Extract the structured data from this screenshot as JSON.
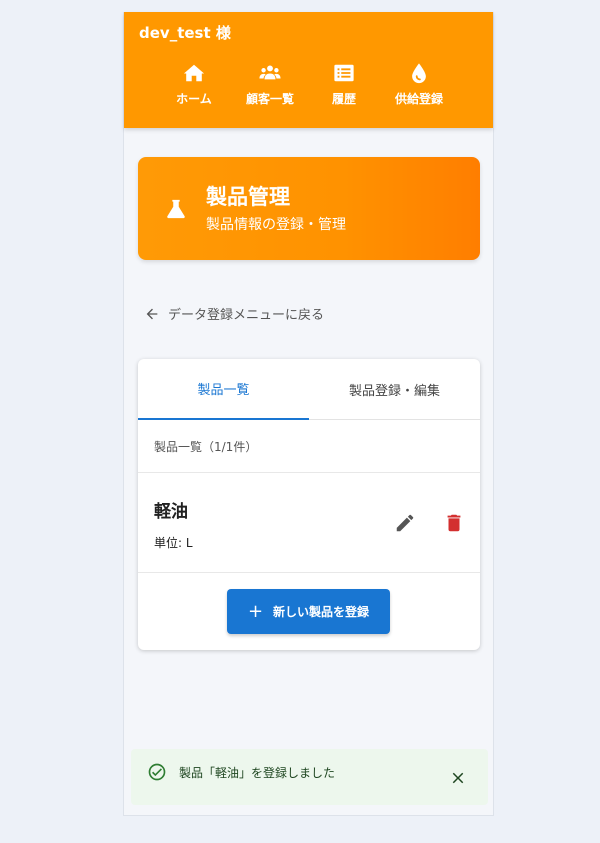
{
  "header": {
    "user": "dev_test 様",
    "nav": [
      {
        "label": "ホーム",
        "icon": "home-icon"
      },
      {
        "label": "顧客一覧",
        "icon": "users-icon"
      },
      {
        "label": "履歴",
        "icon": "list-icon"
      },
      {
        "label": "供給登録",
        "icon": "droplet-icon"
      }
    ]
  },
  "banner": {
    "title": "製品管理",
    "subtitle": "製品情報の登録・管理",
    "icon": "flask-icon"
  },
  "back_link": "データ登録メニューに戻る",
  "tabs": [
    {
      "label": "製品一覧",
      "active": true
    },
    {
      "label": "製品登録・編集",
      "active": false
    }
  ],
  "list": {
    "header": "製品一覧（1/1件）",
    "items": [
      {
        "name": "軽油",
        "unit": "単位: L"
      }
    ]
  },
  "add_button": {
    "icon": "+",
    "label": "新しい製品を登録"
  },
  "toast": {
    "message": "製品「軽油」を登録しました"
  },
  "colors": {
    "header": "#ff9800",
    "accent": "#1976d2",
    "delete": "#d32f2f",
    "success": "#2e7d32"
  }
}
